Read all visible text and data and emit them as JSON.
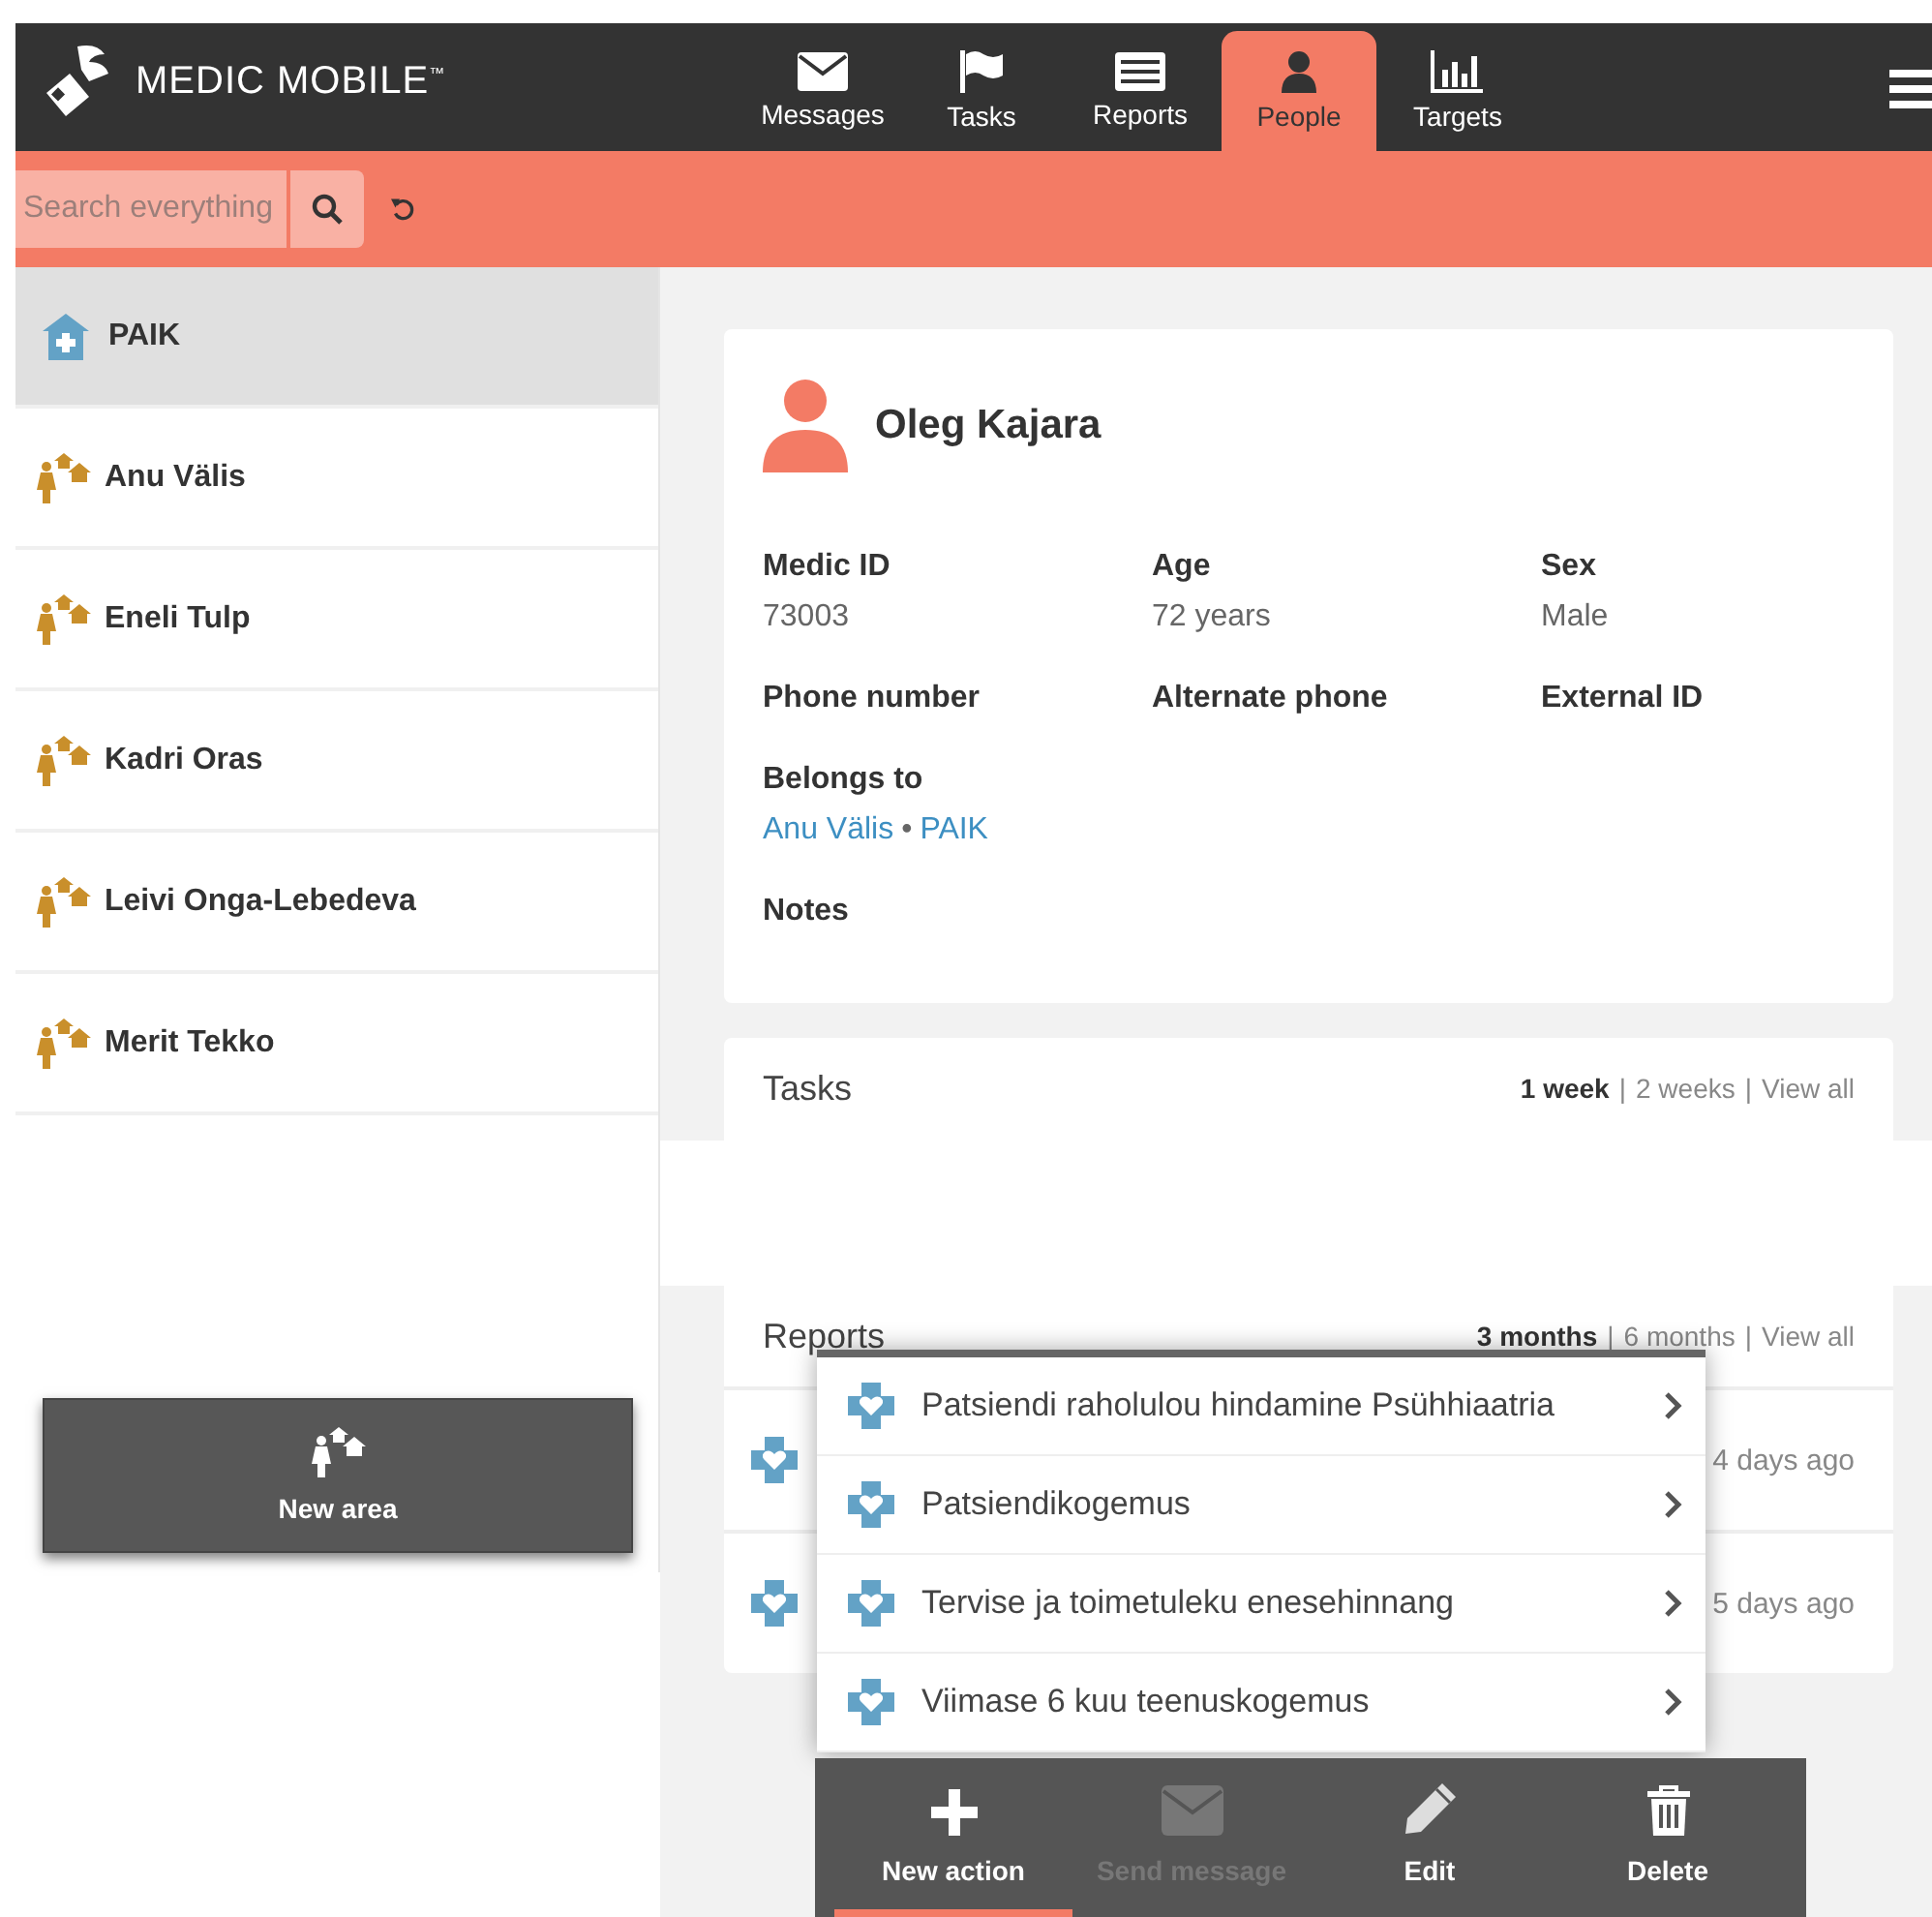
{
  "header": {
    "logo": "MEDIC MOBILE$^{™}$",
    "tabs": [
      {
        "label": "Messages",
        "selected": false
      },
      {
        "label": "Tasks",
        "selected": false
      },
      {
        "label": "Reports",
        "selected": false
      },
      {
        "label": "People",
        "selected": true
      },
      {
        "label": "Targets",
        "selected": false
      }
    ]
  },
  "search": {
    "placeholder": "Search everything"
  },
  "sidebar": {
    "items": [
      {
        "kind": "facility",
        "name": "PAIK",
        "selected": true
      },
      {
        "kind": "area",
        "name": "Anu Välis",
        "selected": false
      },
      {
        "kind": "area",
        "name": "Eneli Tulp",
        "selected": false
      },
      {
        "kind": "area",
        "name": "Kadri Oras",
        "selected": false
      },
      {
        "kind": "area",
        "name": "Leivi Onga-Lebedeva",
        "selected": false
      },
      {
        "kind": "area",
        "name": "Merit Tekko",
        "selected": false
      }
    ],
    "new_button": "New area"
  },
  "contact": {
    "name": "Oleg Kajara",
    "fields": [
      {
        "label": "Medic ID",
        "value": "73003"
      },
      {
        "label": "Age",
        "value": "72 years"
      },
      {
        "label": "Sex",
        "value": "Male"
      },
      {
        "label": "Phone number"
      },
      {
        "label": "Alternate phone"
      },
      {
        "label": "External ID"
      }
    ],
    "belongs_to": {
      "label": "Belongs to",
      "links": [
        "Anu Välis",
        "PAIK"
      ],
      "separator": "•"
    },
    "notes": {
      "label": "Notes"
    }
  },
  "tasks": {
    "title": "Tasks",
    "separator": "|",
    "filters": [
      {
        "label": "1 week",
        "selected": true
      },
      {
        "label": "2 weeks",
        "selected": false
      },
      {
        "label": "View all",
        "selected": false
      }
    ]
  },
  "reports": {
    "title": "Reports",
    "separator": "|",
    "filters": [
      {
        "label": "3 months",
        "selected": true
      },
      {
        "label": "6 months",
        "selected": false
      },
      {
        "label": "View all",
        "selected": false
      }
    ],
    "rows": [
      {
        "date": "4 days ago"
      },
      {
        "date": "5 days ago"
      }
    ]
  },
  "action_menu": {
    "items": [
      "Patsiendi raholulou hindamine Psühhiaatria",
      "Patsiendikogemus",
      "Tervise ja toimetuleku enesehinnang",
      "Viimase 6 kuu teenuskogemus"
    ]
  },
  "actions": [
    {
      "label": "New action",
      "selected": true,
      "disabled": false
    },
    {
      "label": "Send message",
      "selected": false,
      "disabled": true
    },
    {
      "label": "Edit",
      "selected": false,
      "disabled": false
    },
    {
      "label": "Delete",
      "selected": false,
      "disabled": false
    }
  ]
}
